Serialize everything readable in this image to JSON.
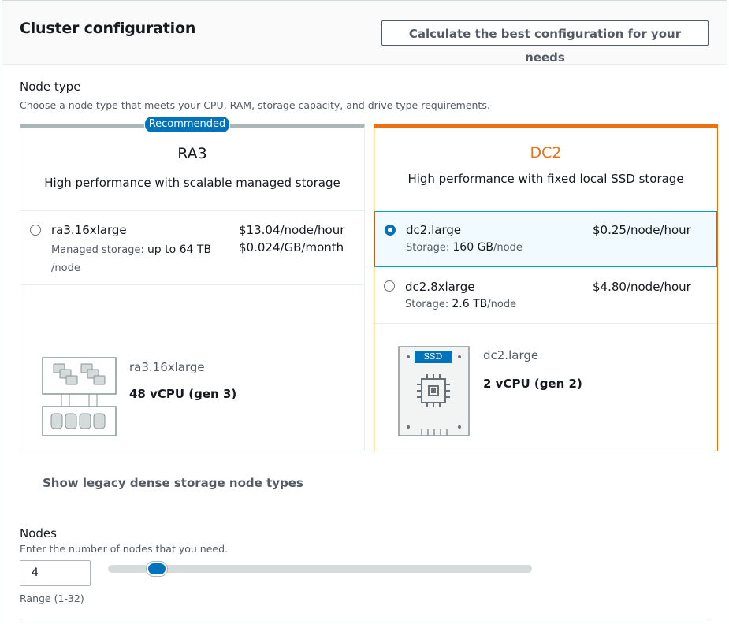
{
  "header": {
    "title": "Cluster configuration",
    "calculate_button": "Calculate the best configuration for your needs"
  },
  "node_type": {
    "label": "Node type",
    "description": "Choose a node type that meets your CPU, RAM, storage capacity, and drive type requirements.",
    "recommended_badge": "Recommended",
    "cards": [
      {
        "title": "RA3",
        "subtitle": "High performance with scalable managed storage",
        "options": [
          {
            "name": "ra3.16xlarge",
            "price_hour": "$13.04/node/hour",
            "price_storage": "$0.024/GB/month",
            "meta_label": "Managed storage:",
            "meta_value": "up to 64 TB",
            "meta_suffix": "/node",
            "selected": false
          }
        ],
        "spec_name": "ra3.16xlarge",
        "spec_value": "48 vCPU (gen 3)"
      },
      {
        "title": "DC2",
        "subtitle": "High performance with fixed local SSD storage",
        "options": [
          {
            "name": "dc2.large",
            "price_hour": "$0.25/node/hour",
            "meta_label": "Storage:",
            "meta_value": "160 GB",
            "meta_suffix": "/node",
            "selected": true
          },
          {
            "name": "dc2.8xlarge",
            "price_hour": "$4.80/node/hour",
            "meta_label": "Storage:",
            "meta_value": "2.6 TB",
            "meta_suffix": "/node",
            "selected": false
          }
        ],
        "ssd_label": "SSD",
        "spec_name": "dc2.large",
        "spec_value": "2 vCPU (gen 2)"
      }
    ],
    "legacy_link": "Show legacy dense storage node types"
  },
  "nodes": {
    "label": "Nodes",
    "description": "Enter the number of nodes that you need.",
    "value": "4",
    "range": "Range (1-32)",
    "slider_min": 1,
    "slider_max": 32,
    "slider_value": 4
  },
  "colors": {
    "accent": "#0073bb",
    "dc2_orange": "#ec7211",
    "selected_bg": "#f1faff"
  }
}
